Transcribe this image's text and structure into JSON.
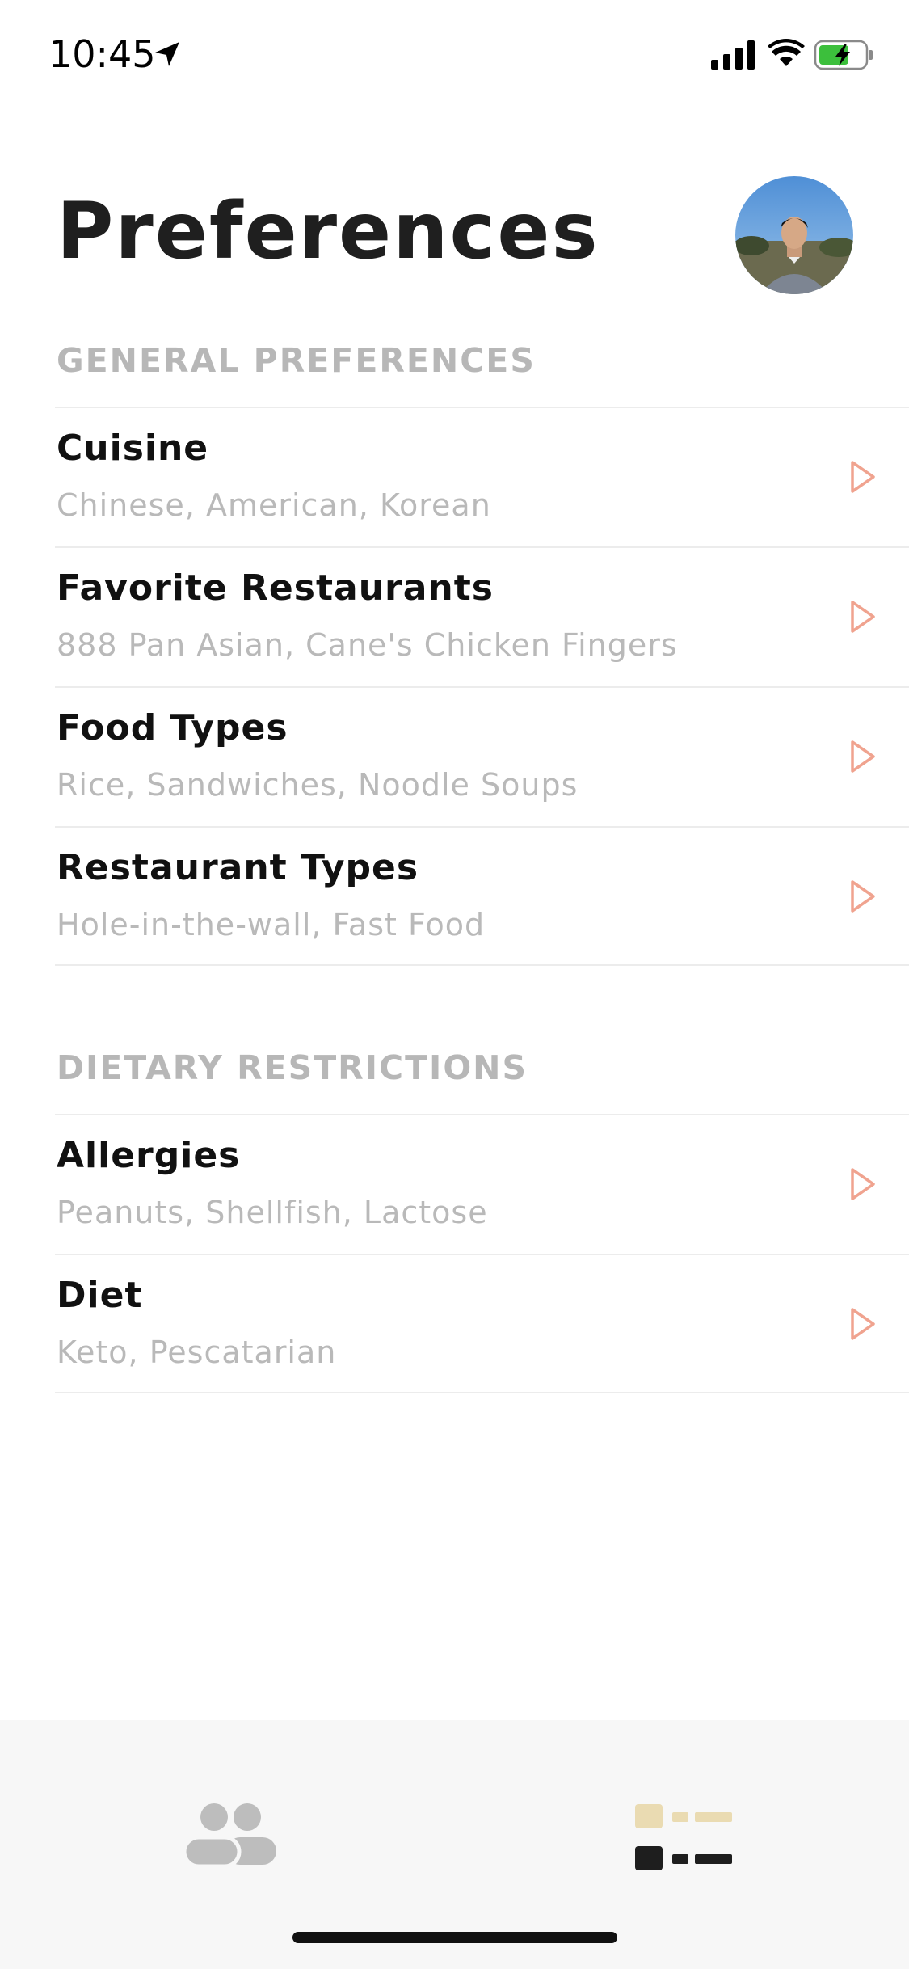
{
  "status_bar": {
    "time": "10:45",
    "icons": [
      "location-arrow-icon",
      "cellular-signal-icon",
      "wifi-icon",
      "battery-charging-icon"
    ],
    "battery_color": "#3cbf3c"
  },
  "header": {
    "title": "Preferences",
    "avatar": "profile-avatar"
  },
  "sections": [
    {
      "header": "GENERAL PREFERENCES",
      "items": [
        {
          "title": "Cuisine",
          "subtitle": "Chinese, American, Korean"
        },
        {
          "title": "Favorite Restaurants",
          "subtitle": "888 Pan Asian, Cane's Chicken Fingers"
        },
        {
          "title": "Food Types",
          "subtitle": "Rice, Sandwiches, Noodle Soups"
        },
        {
          "title": "Restaurant Types",
          "subtitle": "Hole-in-the-wall, Fast Food"
        }
      ]
    },
    {
      "header": "DIETARY RESTRICTIONS",
      "items": [
        {
          "title": "Allergies",
          "subtitle": "Peanuts, Shellfish, Lactose"
        },
        {
          "title": "Diet",
          "subtitle": "Keto, Pescatarian"
        }
      ]
    }
  ],
  "tab_bar": {
    "tabs": [
      {
        "icon": "people-icon",
        "active": false
      },
      {
        "icon": "preferences-list-icon",
        "active": true
      }
    ]
  },
  "colors": {
    "accent": "#f0a38f",
    "section_header": "#b7b7b7",
    "subtitle": "#b9b9b9",
    "tab_active_accent": "#eadbb2",
    "tab_inactive": "#bdbdbd"
  }
}
